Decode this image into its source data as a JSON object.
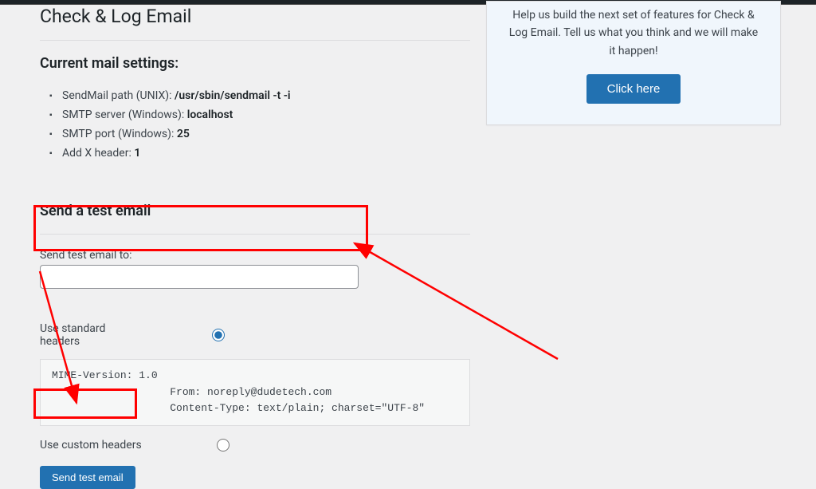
{
  "page": {
    "title": "Check & Log Email"
  },
  "settings": {
    "heading": "Current mail settings:",
    "items": [
      {
        "label": "SendMail path (UNIX): ",
        "value": "/usr/sbin/sendmail -t -i"
      },
      {
        "label": "SMTP server (Windows): ",
        "value": "localhost"
      },
      {
        "label": "SMTP port (Windows): ",
        "value": "25"
      },
      {
        "label": "Add X header: ",
        "value": "1"
      }
    ]
  },
  "test": {
    "heading": "Send a test email",
    "to_label": "Send test email to:",
    "to_value": "",
    "standard_label": "Use standard headers",
    "custom_label": "Use custom headers",
    "headers_text": "MIME-Version: 1.0\n                   From: noreply@dudetech.com\n                   Content-Type: text/plain; charset=\"UTF-8\"",
    "submit_label": "Send test email"
  },
  "sidebar": {
    "text": "Help us build the next set of features for Check & Log Email. Tell us what you think and we will make it happen!",
    "button": "Click here"
  }
}
